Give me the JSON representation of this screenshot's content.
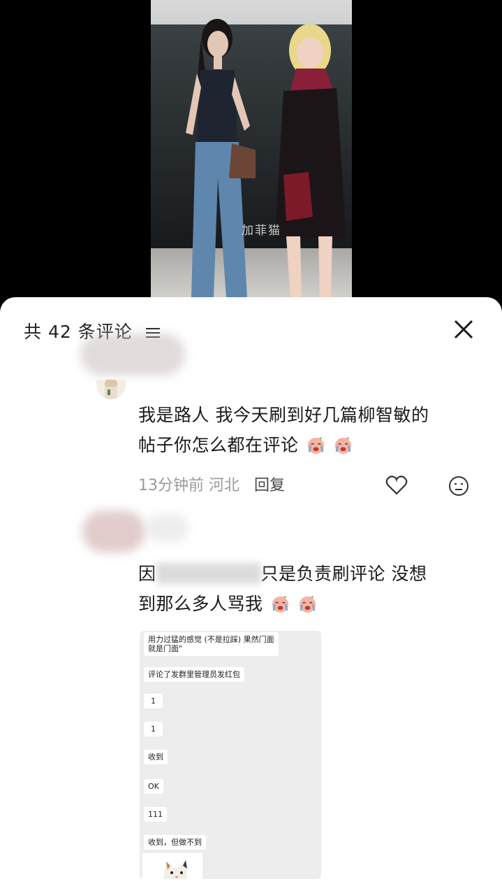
{
  "video": {
    "watermark": "加菲猫"
  },
  "comments_panel": {
    "title": "共 42 条评论",
    "icons": {
      "filter": "filter-lines-icon",
      "close": "close-x-icon"
    }
  },
  "comments": [
    {
      "text_line1": "我是路人 我今天刷到好几篇柳智敏的",
      "text_line2": "帖子你怎么都在评论",
      "emoji": "crying-emoji",
      "time": "13分钟前",
      "location": "河北",
      "reply_label": "回复",
      "icons": {
        "like": "heart-icon",
        "dislike": "neutral-face-icon"
      }
    },
    {
      "text_line1_prefix": "因",
      "text_line1_suffix": "只是负责刷评论 没想",
      "text_line2": "到那么多人骂我",
      "emoji": "crying-emoji",
      "screenshot": {
        "messages": [
          "用力过猛的感觉 (不是拉踩) 果然门面",
          "就是门面\"",
          "评论了发群里管理员发红包",
          "1",
          "1",
          "收到",
          "OK",
          "111",
          "收到，但做不到"
        ]
      }
    }
  ],
  "colors": {
    "sheet_bg": "#ffffff",
    "text_main": "#1a1a1a",
    "text_meta": "#9a9a9a",
    "chat_bg": "#ededed"
  }
}
